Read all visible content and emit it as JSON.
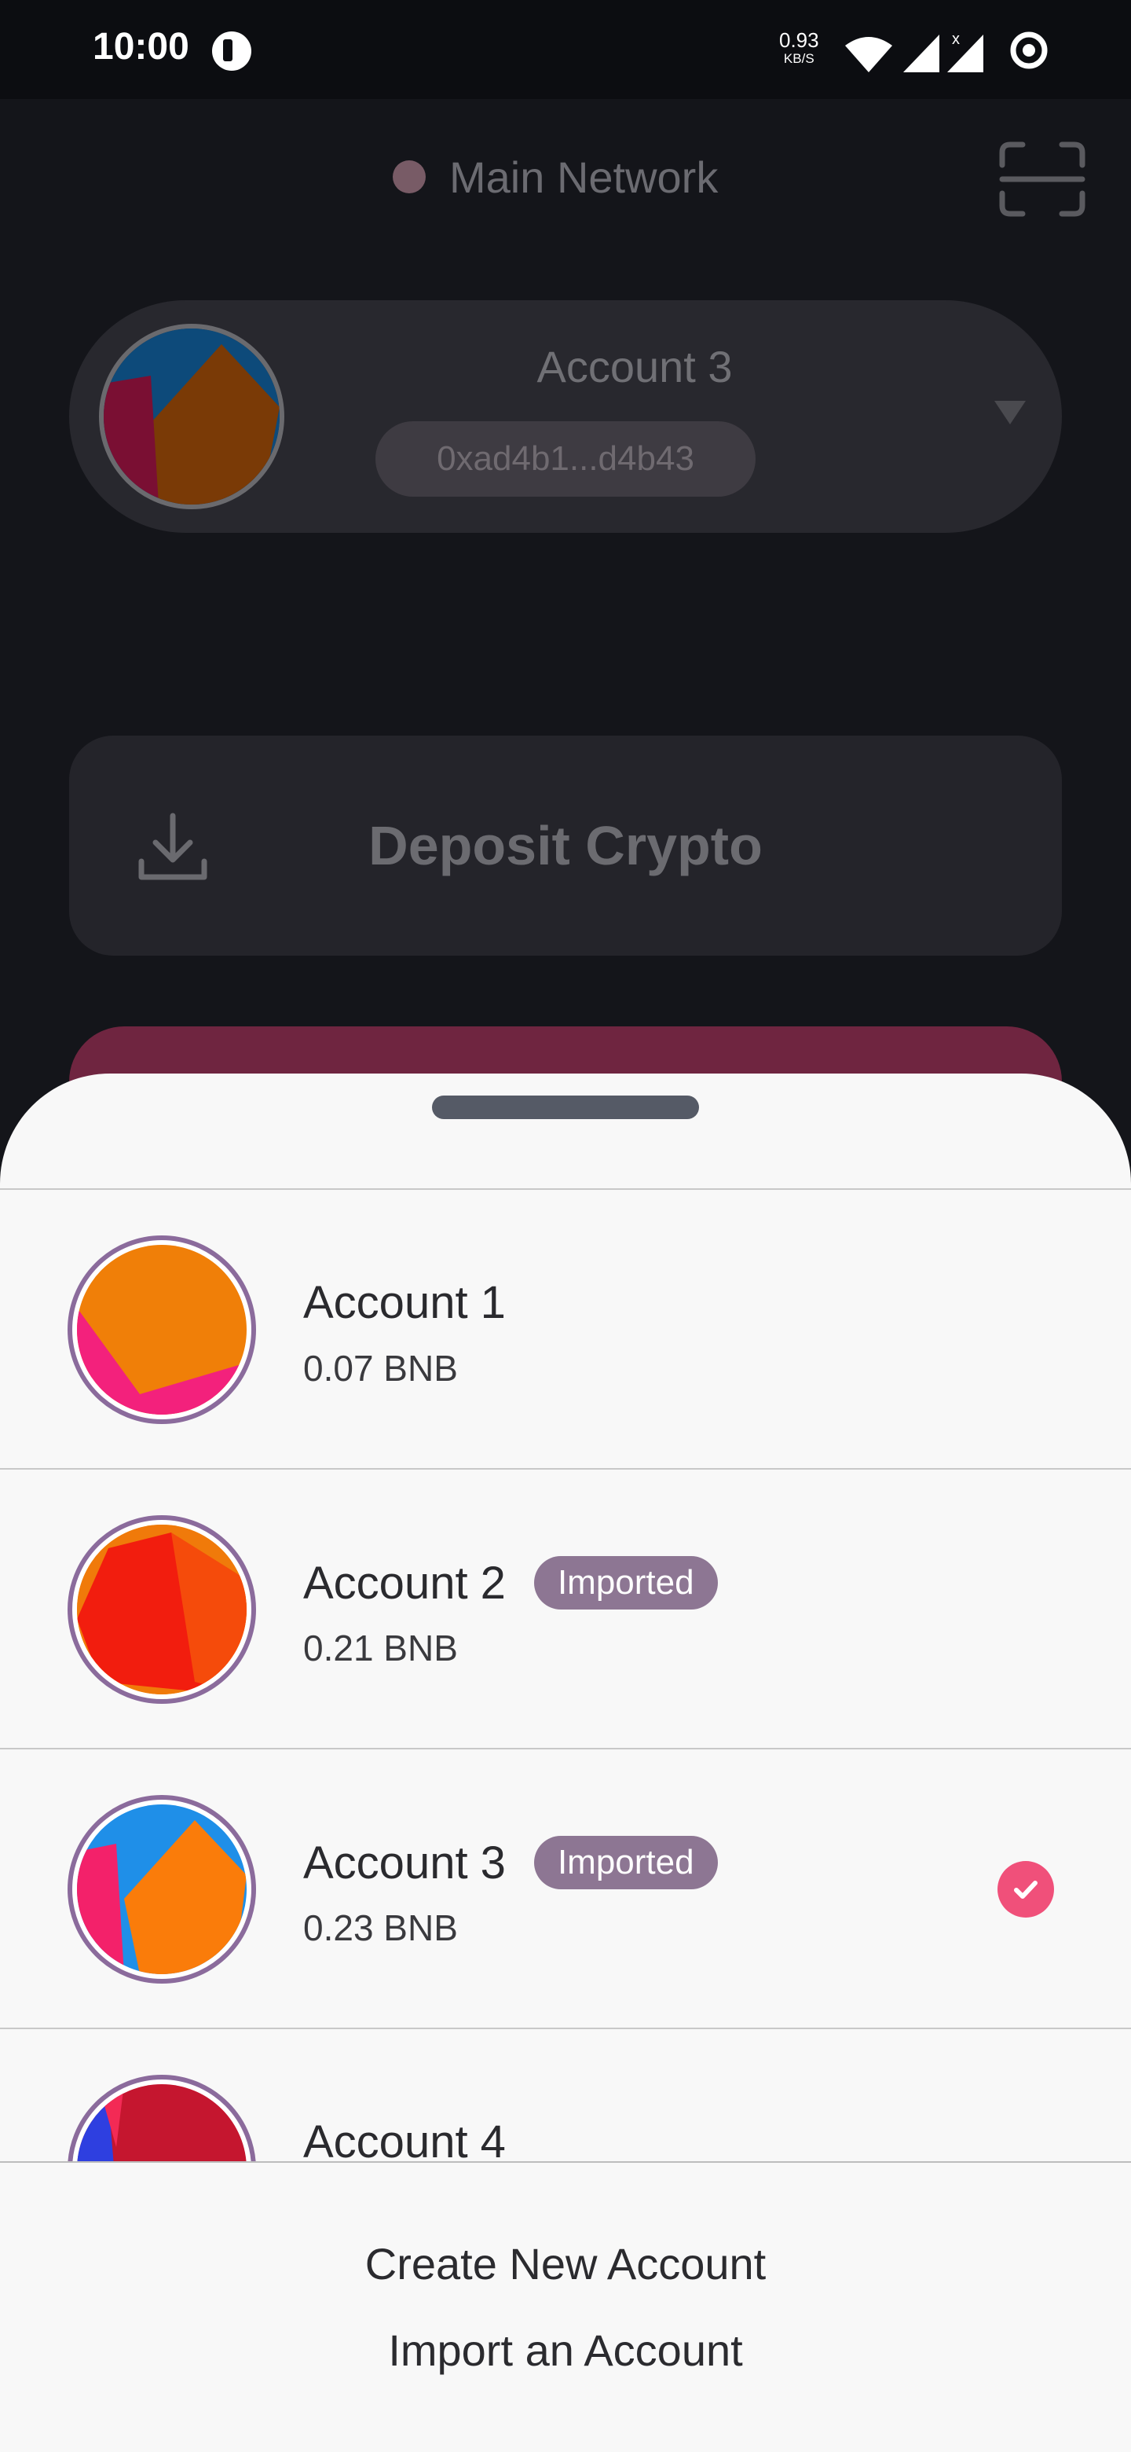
{
  "status_bar": {
    "time": "10:00",
    "speed_value": "0.93",
    "speed_unit": "KB/S",
    "icons": [
      "app-icon",
      "wifi-icon",
      "signal-icon",
      "signal-x-icon",
      "ring-icon"
    ]
  },
  "header": {
    "network_label": "Main Network",
    "network_dot_color": "#785b66",
    "scan_icon": "scan-icon"
  },
  "current_account": {
    "name": "Account 3",
    "address": "0xad4b1...d4b43",
    "caret_icon": "caret-down-icon"
  },
  "deposit": {
    "label": "Deposit Crypto",
    "icon": "download-icon"
  },
  "sheet": {
    "accounts": [
      {
        "name": "Account 1",
        "balance": "0.07 BNB",
        "badge": "",
        "selected": false
      },
      {
        "name": "Account 2",
        "balance": "0.21 BNB",
        "badge": "Imported",
        "selected": false
      },
      {
        "name": "Account 3",
        "balance": "0.23 BNB",
        "badge": "Imported",
        "selected": true
      },
      {
        "name": "Account 4",
        "balance": "",
        "badge": "",
        "selected": false
      }
    ],
    "create_label": "Create New Account",
    "import_label": "Import an Account"
  },
  "colors": {
    "badge": "#8d7693",
    "check": "#f0507a",
    "avatar_ring": "#8b6b9c"
  }
}
